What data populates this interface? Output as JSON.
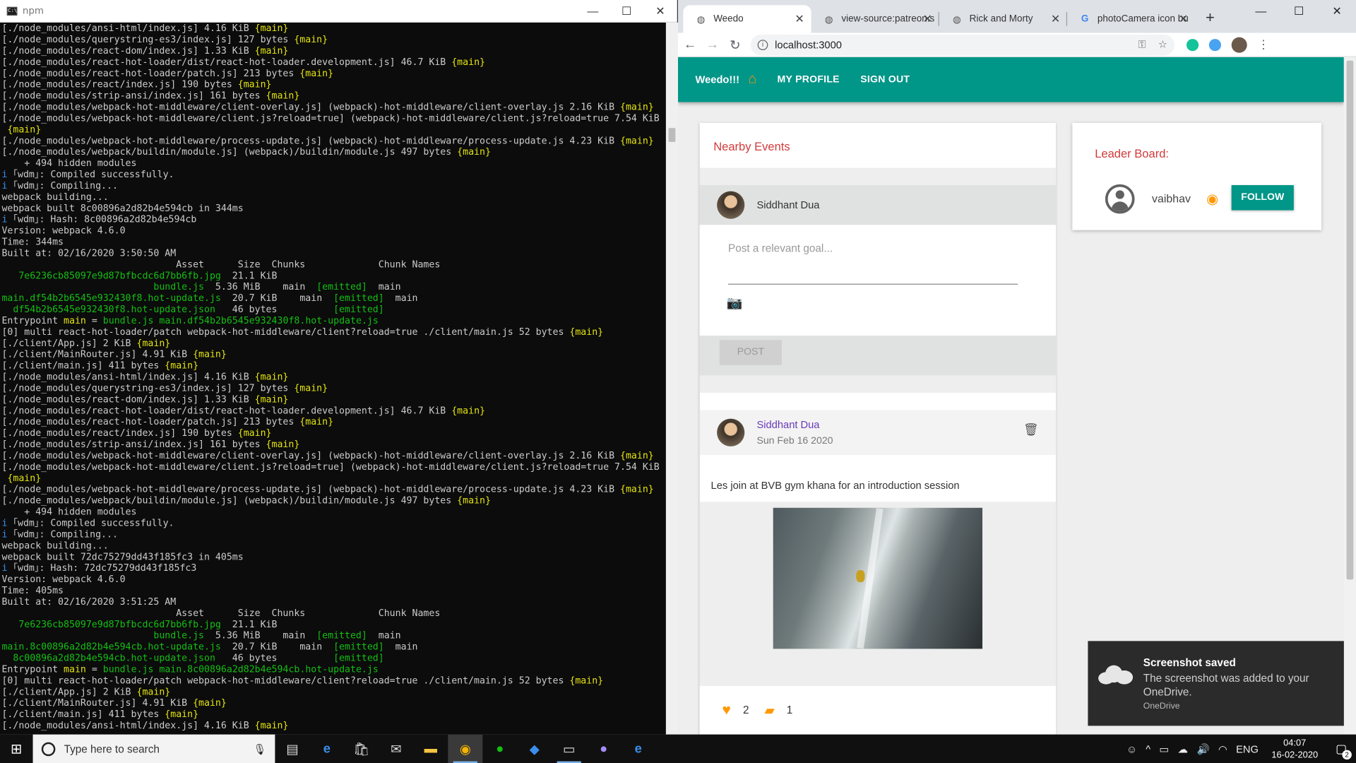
{
  "terminal": {
    "title": "npm",
    "lines": [
      [
        [
          "[./node_modules/ansi-html/index.js] 4.16 KiB ",
          ""
        ],
        [
          "{main}",
          "y"
        ]
      ],
      [
        [
          "[./node_modules/querystring-es3/index.js] 127 bytes ",
          ""
        ],
        [
          "{main}",
          "y"
        ]
      ],
      [
        [
          "[./node_modules/react-dom/index.js] 1.33 KiB ",
          ""
        ],
        [
          "{main}",
          "y"
        ]
      ],
      [
        [
          "[./node_modules/react-hot-loader/dist/react-hot-loader.development.js] 46.7 KiB ",
          ""
        ],
        [
          "{main}",
          "y"
        ]
      ],
      [
        [
          "[./node_modules/react-hot-loader/patch.js] 213 bytes ",
          ""
        ],
        [
          "{main}",
          "y"
        ]
      ],
      [
        [
          "[./node_modules/react/index.js] 190 bytes ",
          ""
        ],
        [
          "{main}",
          "y"
        ]
      ],
      [
        [
          "[./node_modules/strip-ansi/index.js] 161 bytes ",
          ""
        ],
        [
          "{main}",
          "y"
        ]
      ],
      [
        [
          "[./node_modules/webpack-hot-middleware/client-overlay.js] (webpack)-hot-middleware/client-overlay.js 2.16 KiB ",
          ""
        ],
        [
          "{main}",
          "y"
        ]
      ],
      [
        [
          "[./node_modules/webpack-hot-middleware/client.js?reload=true] (webpack)-hot-middleware/client.js?reload=true 7.54 KiB",
          ""
        ]
      ],
      [
        [
          " ",
          ""
        ],
        [
          "{main}",
          "y"
        ]
      ],
      [
        [
          "[./node_modules/webpack-hot-middleware/process-update.js] (webpack)-hot-middleware/process-update.js 4.23 KiB ",
          ""
        ],
        [
          "{main}",
          "y"
        ]
      ],
      [
        [
          "[./node_modules/webpack/buildin/module.js] (webpack)/buildin/module.js 497 bytes ",
          ""
        ],
        [
          "{main}",
          "y"
        ]
      ],
      [
        [
          "    + 494 hidden modules",
          ""
        ]
      ],
      [
        [
          "i ",
          "c"
        ],
        [
          "｢wdm｣: Compiled successfully.",
          ""
        ]
      ],
      [
        [
          "i ",
          "c"
        ],
        [
          "｢wdm｣: Compiling...",
          ""
        ]
      ],
      [
        [
          "webpack building...",
          ""
        ]
      ],
      [
        [
          "webpack built 8c00896a2d82b4e594cb in 344ms",
          ""
        ]
      ],
      [
        [
          "i ",
          "c"
        ],
        [
          "｢wdm｣: Hash: 8c00896a2d82b4e594cb",
          ""
        ]
      ],
      [
        [
          "Version: webpack 4.6.0",
          ""
        ]
      ],
      [
        [
          "Time: 344ms",
          ""
        ]
      ],
      [
        [
          "Built at: 02/16/2020 3:50:50 AM",
          ""
        ]
      ],
      [
        [
          "                               Asset      Size  Chunks             Chunk Names",
          ""
        ]
      ],
      [
        [
          "   7e6236cb85097e9d87bfbcdc6d7bb6fb.jpg",
          "g"
        ],
        [
          "  21.1 KiB",
          ""
        ]
      ],
      [
        [
          "                           bundle.js",
          "g"
        ],
        [
          "  5.36 MiB    main  ",
          ""
        ],
        [
          "[emitted]",
          "g"
        ],
        [
          "  main",
          ""
        ]
      ],
      [
        [
          "main.df54b2b6545e932430f8.hot-update.js",
          "g"
        ],
        [
          "  20.7 KiB    main  ",
          ""
        ],
        [
          "[emitted]",
          "g"
        ],
        [
          "  main",
          ""
        ]
      ],
      [
        [
          "  df54b2b6545e932430f8.hot-update.json",
          "g"
        ],
        [
          "   46 bytes          ",
          ""
        ],
        [
          "[emitted]",
          "g"
        ]
      ],
      [
        [
          "Entrypoint ",
          ""
        ],
        [
          "main",
          "y"
        ],
        [
          " = ",
          ""
        ],
        [
          "bundle.js main.df54b2b6545e932430f8.hot-update.js",
          "g"
        ]
      ],
      [
        [
          "[0] multi react-hot-loader/patch webpack-hot-middleware/client?reload=true ./client/main.js 52 bytes ",
          ""
        ],
        [
          "{main}",
          "y"
        ]
      ],
      [
        [
          "[./client/App.js] 2 KiB ",
          ""
        ],
        [
          "{main}",
          "y"
        ]
      ],
      [
        [
          "[./client/MainRouter.js] 4.91 KiB ",
          ""
        ],
        [
          "{main}",
          "y"
        ]
      ],
      [
        [
          "[./client/main.js] 411 bytes ",
          ""
        ],
        [
          "{main}",
          "y"
        ]
      ],
      [
        [
          "[./node_modules/ansi-html/index.js] 4.16 KiB ",
          ""
        ],
        [
          "{main}",
          "y"
        ]
      ],
      [
        [
          "[./node_modules/querystring-es3/index.js] 127 bytes ",
          ""
        ],
        [
          "{main}",
          "y"
        ]
      ],
      [
        [
          "[./node_modules/react-dom/index.js] 1.33 KiB ",
          ""
        ],
        [
          "{main}",
          "y"
        ]
      ],
      [
        [
          "[./node_modules/react-hot-loader/dist/react-hot-loader.development.js] 46.7 KiB ",
          ""
        ],
        [
          "{main}",
          "y"
        ]
      ],
      [
        [
          "[./node_modules/react-hot-loader/patch.js] 213 bytes ",
          ""
        ],
        [
          "{main}",
          "y"
        ]
      ],
      [
        [
          "[./node_modules/react/index.js] 190 bytes ",
          ""
        ],
        [
          "{main}",
          "y"
        ]
      ],
      [
        [
          "[./node_modules/strip-ansi/index.js] 161 bytes ",
          ""
        ],
        [
          "{main}",
          "y"
        ]
      ],
      [
        [
          "[./node_modules/webpack-hot-middleware/client-overlay.js] (webpack)-hot-middleware/client-overlay.js 2.16 KiB ",
          ""
        ],
        [
          "{main}",
          "y"
        ]
      ],
      [
        [
          "[./node_modules/webpack-hot-middleware/client.js?reload=true] (webpack)-hot-middleware/client.js?reload=true 7.54 KiB",
          ""
        ]
      ],
      [
        [
          " ",
          ""
        ],
        [
          "{main}",
          "y"
        ]
      ],
      [
        [
          "[./node_modules/webpack-hot-middleware/process-update.js] (webpack)-hot-middleware/process-update.js 4.23 KiB ",
          ""
        ],
        [
          "{main}",
          "y"
        ]
      ],
      [
        [
          "[./node_modules/webpack/buildin/module.js] (webpack)/buildin/module.js 497 bytes ",
          ""
        ],
        [
          "{main}",
          "y"
        ]
      ],
      [
        [
          "    + 494 hidden modules",
          ""
        ]
      ],
      [
        [
          "i ",
          "c"
        ],
        [
          "｢wdm｣: Compiled successfully.",
          ""
        ]
      ],
      [
        [
          "i ",
          "c"
        ],
        [
          "｢wdm｣: Compiling...",
          ""
        ]
      ],
      [
        [
          "webpack building...",
          ""
        ]
      ],
      [
        [
          "webpack built 72dc75279dd43f185fc3 in 405ms",
          ""
        ]
      ],
      [
        [
          "i ",
          "c"
        ],
        [
          "｢wdm｣: Hash: 72dc75279dd43f185fc3",
          ""
        ]
      ],
      [
        [
          "Version: webpack 4.6.0",
          ""
        ]
      ],
      [
        [
          "Time: 405ms",
          ""
        ]
      ],
      [
        [
          "Built at: 02/16/2020 3:51:25 AM",
          ""
        ]
      ],
      [
        [
          "                               Asset      Size  Chunks             Chunk Names",
          ""
        ]
      ],
      [
        [
          "   7e6236cb85097e9d87bfbcdc6d7bb6fb.jpg",
          "g"
        ],
        [
          "  21.1 KiB",
          ""
        ]
      ],
      [
        [
          "                           bundle.js",
          "g"
        ],
        [
          "  5.36 MiB    main  ",
          ""
        ],
        [
          "[emitted]",
          "g"
        ],
        [
          "  main",
          ""
        ]
      ],
      [
        [
          "main.8c00896a2d82b4e594cb.hot-update.js",
          "g"
        ],
        [
          "  20.7 KiB    main  ",
          ""
        ],
        [
          "[emitted]",
          "g"
        ],
        [
          "  main",
          ""
        ]
      ],
      [
        [
          "  8c00896a2d82b4e594cb.hot-update.json",
          "g"
        ],
        [
          "   46 bytes          ",
          ""
        ],
        [
          "[emitted]",
          "g"
        ]
      ],
      [
        [
          "Entrypoint ",
          ""
        ],
        [
          "main",
          "y"
        ],
        [
          " = ",
          ""
        ],
        [
          "bundle.js main.8c00896a2d82b4e594cb.hot-update.js",
          "g"
        ]
      ],
      [
        [
          "[0] multi react-hot-loader/patch webpack-hot-middleware/client?reload=true ./client/main.js 52 bytes ",
          ""
        ],
        [
          "{main}",
          "y"
        ]
      ],
      [
        [
          "[./client/App.js] 2 KiB ",
          ""
        ],
        [
          "{main}",
          "y"
        ]
      ],
      [
        [
          "[./client/MainRouter.js] 4.91 KiB ",
          ""
        ],
        [
          "{main}",
          "y"
        ]
      ],
      [
        [
          "[./client/main.js] 411 bytes ",
          ""
        ],
        [
          "{main}",
          "y"
        ]
      ],
      [
        [
          "[./node_modules/ansi-html/index.js] 4.16 KiB ",
          ""
        ],
        [
          "{main}",
          "y"
        ]
      ]
    ]
  },
  "browser": {
    "tabs": [
      {
        "title": "Weedo",
        "icon": "globe-icon",
        "active": true
      },
      {
        "title": "view-source:patreon.s",
        "icon": "globe-icon",
        "active": false
      },
      {
        "title": "Rick and Morty",
        "icon": "globe-icon",
        "active": false
      },
      {
        "title": "photoCamera icon bu",
        "icon": "google-icon",
        "active": false
      }
    ],
    "url": "localhost:3000"
  },
  "app": {
    "brand": "Weedo!!!",
    "nav": [
      "MY PROFILE",
      "SIGN OUT"
    ],
    "events_title": "Nearby Events",
    "composer": {
      "user": "Siddhant Dua",
      "placeholder": "Post a relevant goal...",
      "post_button": "POST"
    },
    "post": {
      "author": "Siddhant Dua",
      "date": "Sun Feb 16 2020",
      "text": "Les join at BVB gym khana for an introduction session",
      "likes": "2",
      "comments": "1"
    },
    "leaderboard": {
      "title": "Leader Board:",
      "user": "vaibhav",
      "follow_button": "FOLLOW"
    },
    "colors": {
      "primary": "#009688",
      "accent": "#ff9800",
      "title_red": "#d23a3a"
    }
  },
  "toast": {
    "title": "Screenshot saved",
    "body": "The screenshot was added to your OneDrive.",
    "source": "OneDrive"
  },
  "taskbar": {
    "search_placeholder": "Type here to search",
    "language": "ENG",
    "time": "04:07",
    "date": "16-02-2020",
    "notifications": "2"
  }
}
